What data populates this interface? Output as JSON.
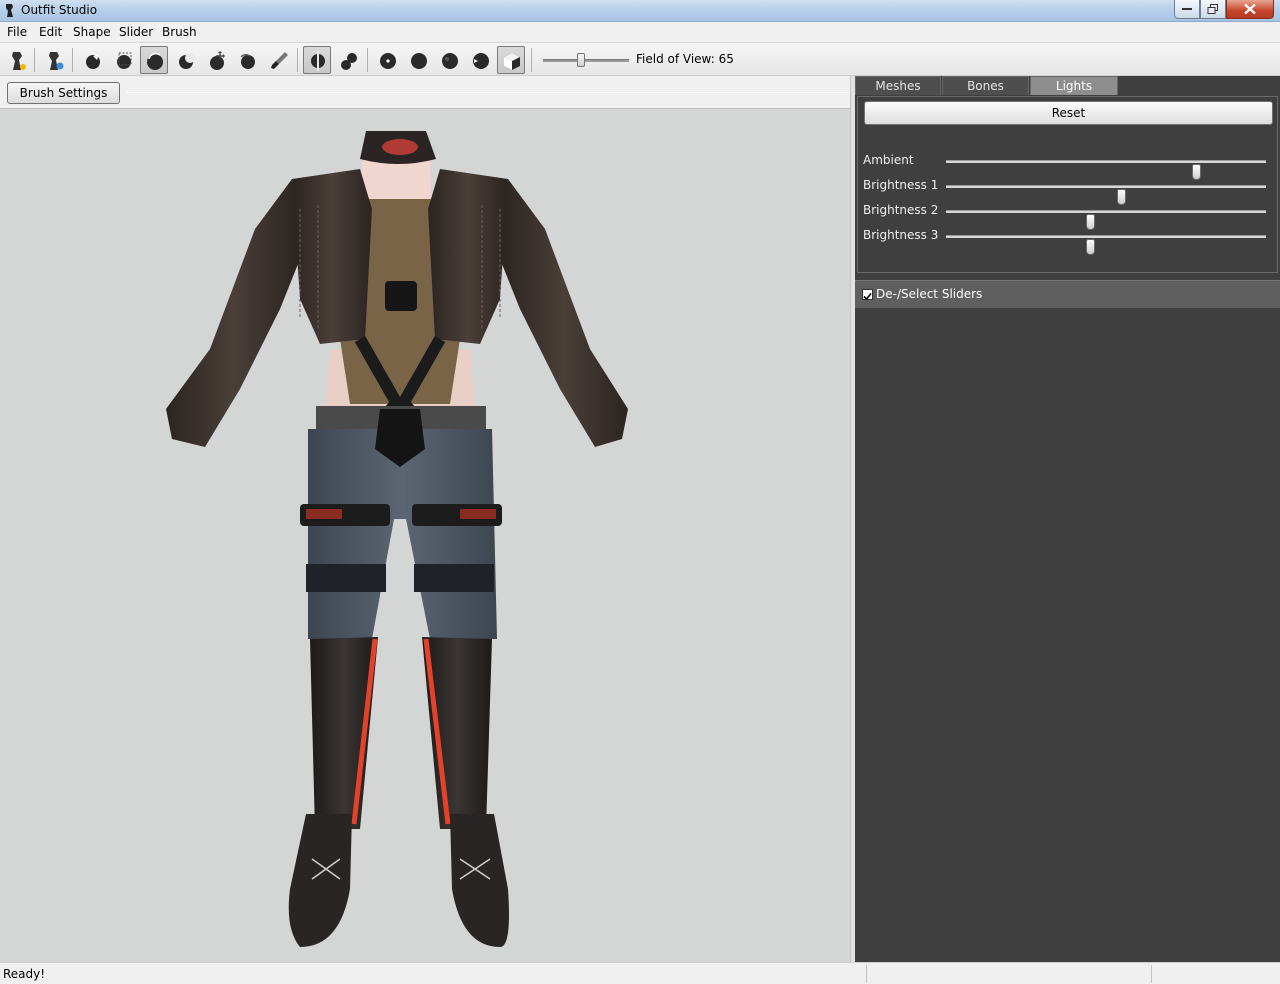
{
  "window": {
    "title": "Outfit Studio"
  },
  "menu": [
    "File",
    "Edit",
    "Shape",
    "Slider",
    "Brush"
  ],
  "toolbar": {
    "fov_label": "Field of View: 65",
    "fov_value": 65
  },
  "brush_settings_label": "Brush Settings >>",
  "tabs": [
    "Meshes",
    "Bones",
    "Lights"
  ],
  "selected_tab": "Lights",
  "lights": {
    "reset_label": "Reset",
    "rows": [
      {
        "label": "Ambient",
        "value": 0.79
      },
      {
        "label": "Brightness 1",
        "value": 0.55
      },
      {
        "label": "Brightness 2",
        "value": 0.45
      },
      {
        "label": "Brightness 3",
        "value": 0.45
      }
    ]
  },
  "sliders_panel": {
    "checkbox_label": "De-/Select Sliders",
    "checked": true
  },
  "status": {
    "text": "Ready!"
  },
  "colors": {
    "viewport_bg": "#d4d5d5",
    "panel_bg": "#3f3f3f",
    "jacket": "#3a302b",
    "denim": "#4a5460",
    "accent_red": "#e4412a"
  }
}
